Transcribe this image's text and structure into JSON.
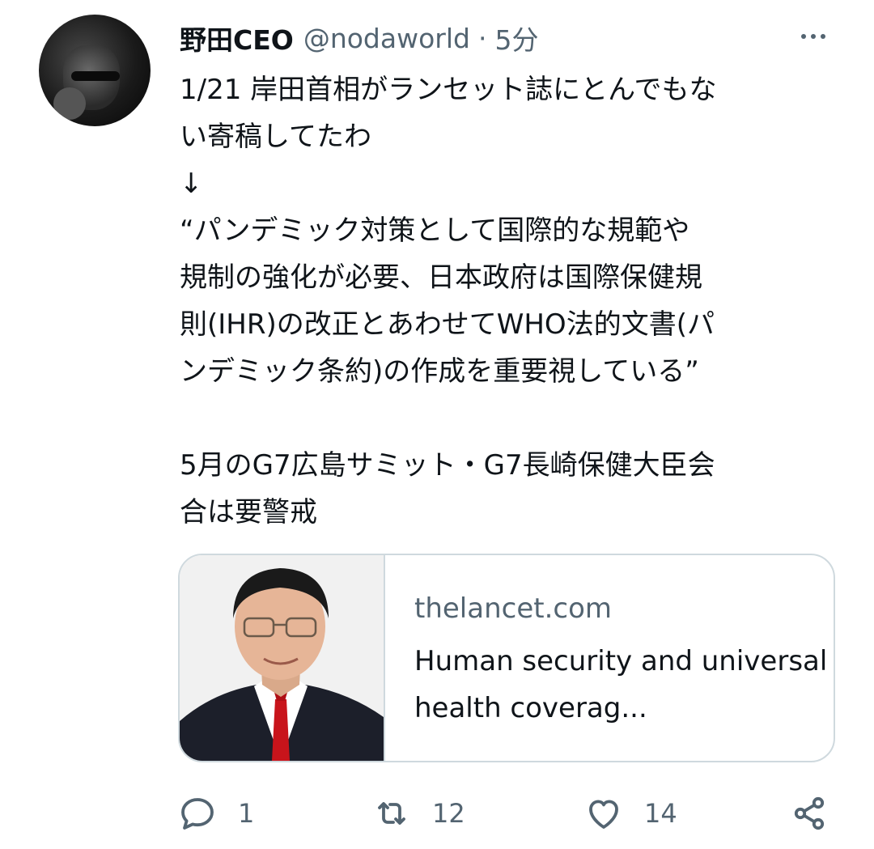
{
  "tweet": {
    "author_name": "野田CEO",
    "handle": "@nodaworld",
    "separator": "·",
    "time": "5分",
    "text": "1/21 岸田首相がランセット誌にとんでもな\nい寄稿してたわ\n↓\n“パンデミック対策として国際的な規範や\n規制の強化が必要、日本政府は国際保健規\n則(IHR)の改正とあわせてWHO法的文書(パ\nンデミック条約)の作成を重要視している”\n\n5月のG7広島サミット・G7長崎保健大臣会\n合は要警戒"
  },
  "card": {
    "domain": "thelancet.com",
    "title": "Human security and universal health coverag..."
  },
  "actions": {
    "reply_count": "1",
    "retweet_count": "12",
    "like_count": "14"
  },
  "icons": {
    "more": "more-icon",
    "reply": "reply-icon",
    "retweet": "retweet-icon",
    "like": "heart-icon",
    "share": "share-icon"
  },
  "colors": {
    "text": "#0f1419",
    "secondary": "#536471",
    "border": "#cfd9de"
  }
}
